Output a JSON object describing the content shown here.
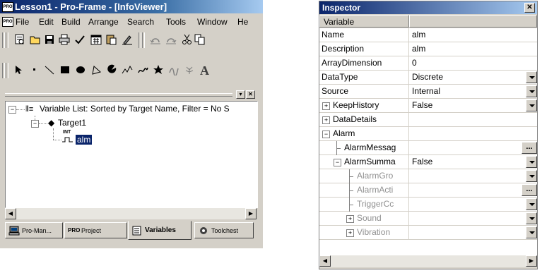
{
  "main_window": {
    "title": "Lesson1 - Pro-Frame - [InfoViewer]",
    "logo_text": "PRO",
    "menu": [
      "File",
      "Edit",
      "Build",
      "Arrange",
      "Search",
      "Tools",
      "Window",
      "He"
    ],
    "toolbar1_icons": [
      "print-preview-icon",
      "open-folder-icon",
      "save-icon",
      "print-icon",
      "check-icon",
      "calendar-icon",
      "paste-special-icon",
      "pen-icon",
      "undo-icon",
      "redo-icon",
      "cut-icon",
      "copy-icon"
    ],
    "toolbar2_icons": [
      "arrow-pointer-icon",
      "point-icon",
      "line-icon",
      "rectangle-icon",
      "ellipse-icon",
      "polygon-icon",
      "pie-icon",
      "polyline-icon",
      "freehand-icon",
      "star-icon",
      "bezier-icon",
      "plant-icon",
      "text-icon"
    ],
    "tree": {
      "root_label": "Variable List: Sorted by Target Name, Filter = No S",
      "target_label": "Target1",
      "var_type": "INT",
      "var_label": "alm"
    },
    "tabs": [
      {
        "label": "Pro-Man...",
        "icon": "computer-icon",
        "active": false
      },
      {
        "label": "Project",
        "icon": "pro-logo-icon",
        "active": false
      },
      {
        "label": "Variables",
        "icon": "variables-icon",
        "active": true
      },
      {
        "label": "Toolchest",
        "icon": "toolchest-icon",
        "active": false
      }
    ]
  },
  "inspector": {
    "title": "Inspector",
    "header": "Variable",
    "rows": [
      {
        "name": "Name",
        "value": "alm",
        "control": "",
        "expander": "",
        "indent": 0,
        "dim": false
      },
      {
        "name": "Description",
        "value": "alm",
        "control": "",
        "expander": "",
        "indent": 0,
        "dim": false
      },
      {
        "name": "ArrayDimension",
        "value": "0",
        "control": "",
        "expander": "",
        "indent": 0,
        "dim": false
      },
      {
        "name": "DataType",
        "value": "Discrete",
        "control": "dropdown",
        "expander": "",
        "indent": 0,
        "dim": false
      },
      {
        "name": "Source",
        "value": "Internal",
        "control": "dropdown",
        "expander": "",
        "indent": 0,
        "dim": false
      },
      {
        "name": "KeepHistory",
        "value": "False",
        "control": "dropdown",
        "expander": "+",
        "indent": 0,
        "dim": false
      },
      {
        "name": "DataDetails",
        "value": "",
        "control": "",
        "expander": "+",
        "indent": 0,
        "dim": false
      },
      {
        "name": "Alarm",
        "value": "",
        "control": "",
        "expander": "−",
        "indent": 0,
        "dim": false
      },
      {
        "name": "AlarmMessag",
        "value": "",
        "control": "ellipsis",
        "expander": "",
        "indent": 1,
        "dim": false
      },
      {
        "name": "AlarmSumma",
        "value": "False",
        "control": "dropdown",
        "expander": "−",
        "indent": 1,
        "dim": false
      },
      {
        "name": "AlarmGro",
        "value": "",
        "control": "dropdown",
        "expander": "",
        "indent": 2,
        "dim": true
      },
      {
        "name": "AlarmActi",
        "value": "",
        "control": "ellipsis",
        "expander": "",
        "indent": 2,
        "dim": true
      },
      {
        "name": "TriggerCc",
        "value": "",
        "control": "dropdown",
        "expander": "",
        "indent": 2,
        "dim": true
      },
      {
        "name": "Sound",
        "value": "",
        "control": "dropdown",
        "expander": "+",
        "indent": 2,
        "dim": true
      },
      {
        "name": "Vibration",
        "value": "",
        "control": "dropdown",
        "expander": "+",
        "indent": 2,
        "dim": true
      }
    ]
  }
}
